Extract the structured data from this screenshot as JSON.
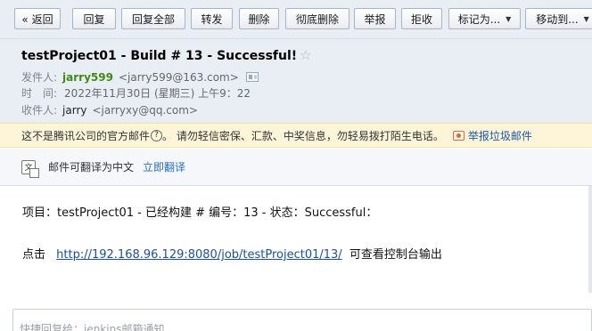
{
  "toolbar": {
    "back": "« 返回",
    "reply": "回复",
    "reply_all": "回复全部",
    "forward": "转发",
    "delete": "删除",
    "delete_permanently": "彻底删除",
    "report": "举报",
    "reject": "拒收",
    "mark_as": "标记为...",
    "move_to": "移动到..."
  },
  "email": {
    "subject": "testProject01 - Build # 13 - Successful!",
    "from_label": "发件人:",
    "from_name": "jarry599",
    "from_address": "<jarry599@163.com>",
    "time_label": "时　间:",
    "time_value": "2022年11月30日 (星期三) 上午9：22",
    "to_label": "收件人:",
    "to_name": "jarry",
    "to_address": "<jarryxy@qq.com>"
  },
  "warning": {
    "notice": "这不是腾讯公司的官方邮件",
    "help_symbol": "?",
    "advice": "。 请勿轻信密保、汇款、中奖信息，勿轻易拨打陌生电话。",
    "report_link": "举报垃圾邮件"
  },
  "translate": {
    "icon_text": "文",
    "text": "邮件可翻译为中文",
    "link": "立即翻译"
  },
  "body": {
    "line1": "项目：testProject01 - 已经构建 # 编号：13 - 状态：Successful：",
    "line2_prefix": "点击",
    "line2_url": "http://192.168.96.129:8080/job/testProject01/13/",
    "line2_suffix": "可查看控制台输出"
  },
  "quick_reply": {
    "placeholder": "快捷回复给：jenkins邮箱通知"
  }
}
